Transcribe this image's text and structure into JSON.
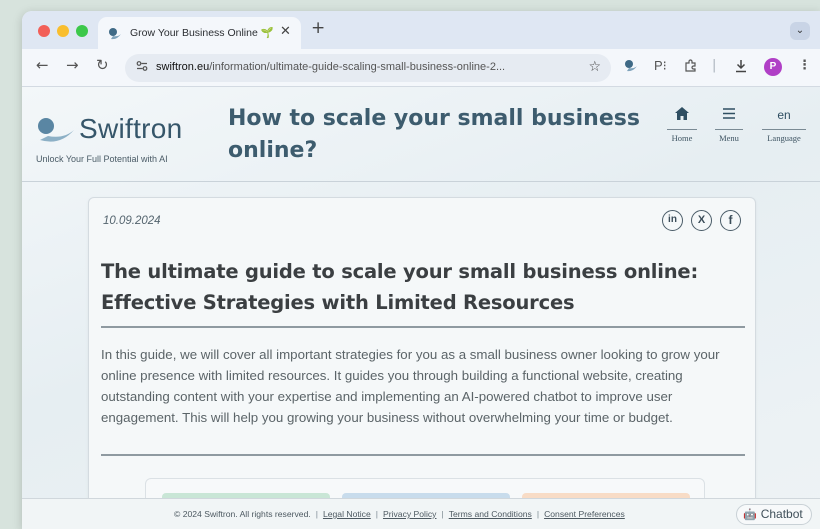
{
  "browser": {
    "tab_title": "Grow Your Business Online 🌱",
    "tab_close": "✕",
    "new_tab": "+",
    "tab_search": "⌄",
    "url_host": "swiftron.eu",
    "url_path": "/information/ultimate-guide-scaling-small-business-online-2...",
    "profile_initial": "P",
    "nav": {
      "back": "←",
      "forward": "→",
      "reload": "↻"
    },
    "traffic_colors": [
      "#f25f58",
      "#f9be2e",
      "#3cc84a"
    ]
  },
  "site": {
    "brand": "Swiftron",
    "tagline": "Unlock Your Full Potential with AI",
    "header_title": "How to scale your small business online?",
    "nav": [
      {
        "icon": "home-icon",
        "label": "Home"
      },
      {
        "icon": "menu-icon",
        "label": "Menu"
      },
      {
        "icon": "",
        "value": "en",
        "label": "Language"
      }
    ],
    "accent": "#36566a"
  },
  "article": {
    "date": "10.09.2024",
    "social": [
      "in",
      "X",
      "f"
    ],
    "title": "The ultimate guide to scale your small business online: Effective Strategies with Limited Resources",
    "intro": "In this guide, we will cover all important strategies for you as a small business owner looking to grow your online presence with limited resources. It guides you through building a functional website, creating outstanding content with your expertise and implementing an AI-powered chatbot to improve user engagement. This will help you growing your business without overwhelming your time or budget.",
    "tile_colors": [
      "#c9e6d6",
      "#c8dcec",
      "#f8dcc6"
    ]
  },
  "footer": {
    "copyright": "© 2024 Swiftron. All rights reserved.",
    "links": [
      "Legal Notice",
      "Privacy Policy",
      "Terms and Conditions",
      "Consent Preferences"
    ],
    "separator": "|",
    "chatbot_label": "Chatbot"
  }
}
